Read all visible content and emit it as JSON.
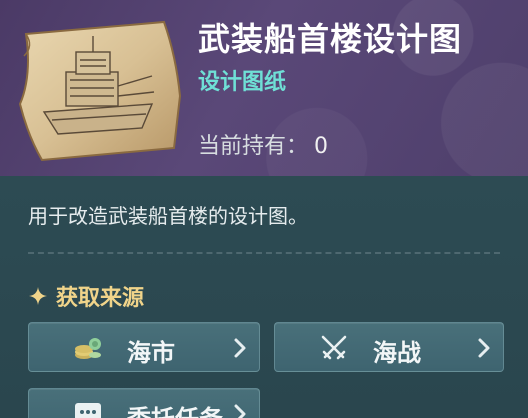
{
  "item": {
    "title": "武装船首楼设计图",
    "type": "设计图纸",
    "owned_label": "当前持有：",
    "owned_value": "0",
    "description": "用于改造武装船首楼的设计图。"
  },
  "sources": {
    "title": "获取来源",
    "buttons": [
      {
        "label": "海市",
        "icon": "coin-stack-icon"
      },
      {
        "label": "海战",
        "icon": "crossed-swords-icon"
      },
      {
        "label": "委托任务",
        "icon": "speech-bubble-icon"
      }
    ]
  },
  "colors": {
    "header_bg": "#5a4878",
    "panel_bg": "#2e4a52",
    "item_type": "#6fe0d6",
    "section_title": "#f0d48a",
    "button_bg": "#49707a"
  }
}
